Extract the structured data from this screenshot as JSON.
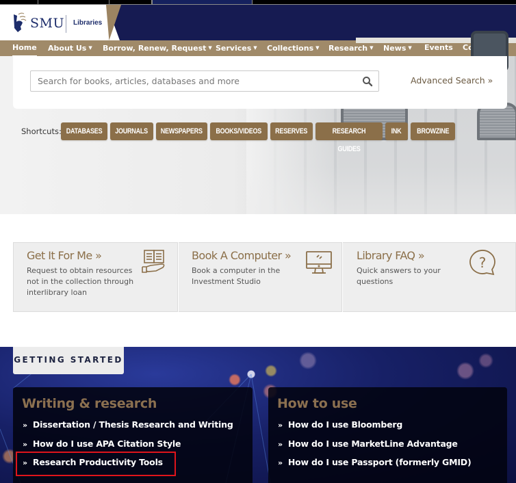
{
  "header": {
    "logo_text": "SMU",
    "logo_subtitle": "Libraries"
  },
  "nav": {
    "items": [
      {
        "label": "Home",
        "dropdown": false,
        "active": true
      },
      {
        "label": "About Us",
        "dropdown": true
      },
      {
        "label": "Borrow, Renew, Request",
        "dropdown": true
      },
      {
        "label": "Services",
        "dropdown": true
      },
      {
        "label": "Collections",
        "dropdown": true
      },
      {
        "label": "Research",
        "dropdown": true
      },
      {
        "label": "News",
        "dropdown": true
      },
      {
        "label": "Events",
        "dropdown": false
      },
      {
        "label": "Contact Us",
        "dropdown": false
      }
    ],
    "caret": "▼"
  },
  "search": {
    "placeholder": "Search for books, articles, databases and more",
    "value": "",
    "icon": "search-icon",
    "advanced_label": "Advanced Search »"
  },
  "shortcuts": {
    "label": "Shortcuts:",
    "items": [
      "DATABASES",
      "JOURNALS",
      "NEWSPAPERS",
      "BOOKS/VIDEOS",
      "RESERVES",
      "RESEARCH GUIDES",
      "INK",
      "BROWZINE"
    ]
  },
  "quick_links": [
    {
      "title": "Get It For Me »",
      "description": "Request to obtain resources not in the collection through interlibrary loan",
      "icon": "book-hand-icon"
    },
    {
      "title": "Book A Computer »",
      "description": "Book a computer in the Investment Studio",
      "icon": "monitor-icon"
    },
    {
      "title": "Library FAQ »",
      "description": "Quick answers to your questions",
      "icon": "question-bubble-icon"
    }
  ],
  "getting_started": {
    "tab_label": "GETTING STARTED",
    "bullet": "»",
    "panels": [
      {
        "title": "Writing & research",
        "links": [
          "Dissertation / Thesis Research and Writing",
          "How do I use APA Citation Style",
          "Research Productivity Tools"
        ]
      },
      {
        "title": "How to use",
        "links": [
          "How do I use Bloomberg",
          "How do I use MarketLine Advantage",
          "How do I use Passport (formerly GMID)"
        ]
      }
    ]
  },
  "colors": {
    "brand_navy": "#161b52",
    "brand_tan": "#a08a69",
    "button_brown": "#8b6f49",
    "highlight_red": "#e0141b"
  }
}
